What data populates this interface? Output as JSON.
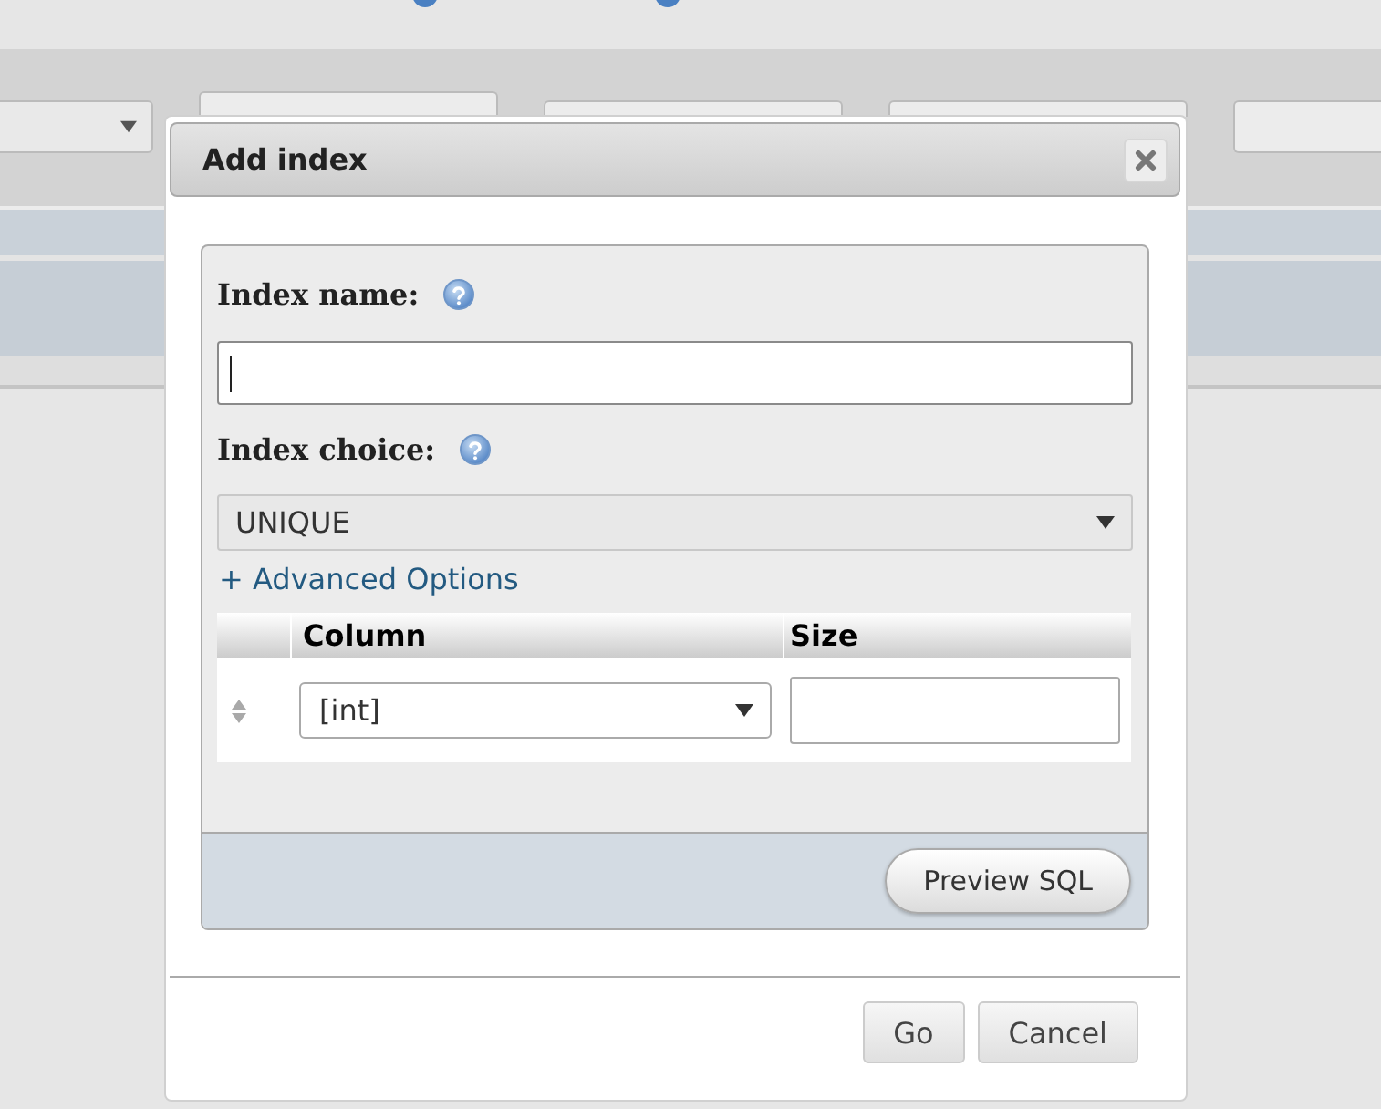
{
  "dialog": {
    "title": "Add index"
  },
  "index_name": {
    "label": "Index name:",
    "focused": true
  },
  "index_choice": {
    "label": "Index choice:",
    "value": "UNIQUE"
  },
  "advanced_options": {
    "label": "+ Advanced Options"
  },
  "index_columns": {
    "columns": [
      "Column",
      "Size"
    ],
    "rows": [
      {
        "column": "[int]"
      }
    ]
  },
  "preview_button": {
    "label": "Preview SQL"
  },
  "buttons": [
    "Go",
    "Cancel"
  ]
}
